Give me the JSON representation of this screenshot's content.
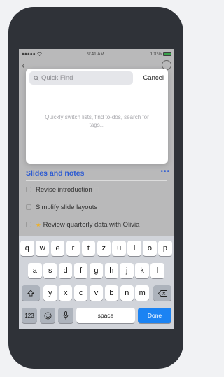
{
  "status_bar": {
    "carrier": "●●●●● ",
    "time": "9:41 AM",
    "battery": "100%"
  },
  "quick_find": {
    "placeholder": "Quick Find",
    "cancel_label": "Cancel",
    "hint": "Quickly switch lists, find to-dos, search for tags..."
  },
  "list": {
    "title": "Slides and notes",
    "more": "•••",
    "todos": [
      {
        "label": "Revise introduction",
        "starred": false,
        "has_note": true
      },
      {
        "label": "Simplify slide layouts",
        "starred": false,
        "has_note": false
      },
      {
        "label": "Review quarterly data with Olivia",
        "starred": true,
        "has_note": false
      }
    ]
  },
  "keyboard": {
    "row1": [
      "q",
      "w",
      "e",
      "r",
      "t",
      "z",
      "u",
      "i",
      "o",
      "p"
    ],
    "row2": [
      "a",
      "s",
      "d",
      "f",
      "g",
      "h",
      "j",
      "k",
      "l"
    ],
    "row3": [
      "y",
      "x",
      "c",
      "v",
      "b",
      "n",
      "m"
    ],
    "numbers_label": "123",
    "space_label": "space",
    "done_label": "Done"
  },
  "colors": {
    "accent": "#2d5bd2",
    "done_key": "#1b83f3"
  }
}
